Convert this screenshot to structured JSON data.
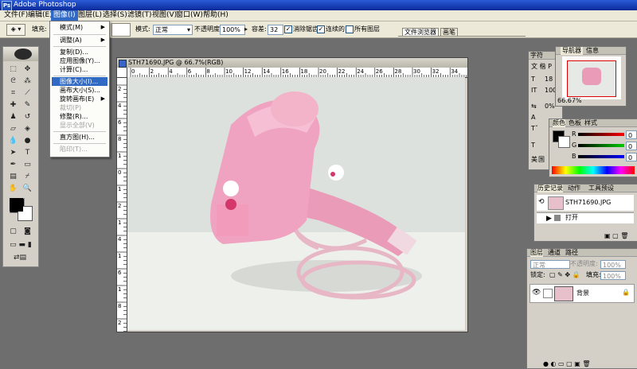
{
  "app": {
    "title": "Adobe Photoshop",
    "logo": "Ps"
  },
  "menu": [
    "文件(F)",
    "编辑(E)",
    "图像(I)",
    "图层(L)",
    "选择(S)",
    "滤镜(T)",
    "视图(V)",
    "窗口(W)",
    "帮助(H)"
  ],
  "options": {
    "fill_label": "填充:",
    "mode_label": "模式:",
    "mode_value": "正常",
    "opacity_label": "不透明度:",
    "opacity_value": "100%",
    "tolerance_label": "容差:",
    "tolerance_value": "32",
    "antialias_label": "消除锯齿",
    "contiguous_label": "连续的",
    "all_layers_label": "所有图层",
    "right_tabs": [
      "文件浏览器",
      "画笔"
    ]
  },
  "image_menu": {
    "items": [
      "模式(M)",
      "调整(A)",
      "复制(D)...",
      "应用图像(Y)...",
      "计算(C)...",
      "图像大小(I)...",
      "画布大小(S)...",
      "旋转画布(E)",
      "裁切(P)",
      "修整(R)...",
      "显示全部(V)",
      "直方图(H)...",
      "陷印(T)..."
    ]
  },
  "document": {
    "title": "STH71690.JPG @ 66.7%(RGB)",
    "ruler_labels": [
      "0",
      "2",
      "4",
      "6",
      "8",
      "10",
      "12",
      "14",
      "16",
      "18",
      "20",
      "22",
      "24",
      "26",
      "28",
      "30",
      "32",
      "34"
    ],
    "ruler_v_labels": [
      "2",
      "4",
      "6",
      "8",
      "1",
      "0",
      "1",
      "2",
      "1",
      "4",
      "1",
      "6",
      "1",
      "8",
      "2"
    ]
  },
  "character_panel": {
    "tabs": [
      "字符",
      "段落"
    ],
    "font_row": "文 楷 P",
    "size1": "18",
    "size2": "100",
    "pct": "0%"
  },
  "navigator_panel": {
    "tabs": [
      "导航器",
      "信息"
    ],
    "zoom": "66.67%"
  },
  "color_panel": {
    "tabs": [
      "颜色",
      "色板",
      "样式"
    ],
    "r_label": "R",
    "g_label": "G",
    "b_label": "B",
    "r_value": "0",
    "g_value": "0",
    "b_value": "0"
  },
  "history_panel": {
    "tabs": [
      "历史记录",
      "动作",
      "工具预设"
    ],
    "snapshot": "STH71690.JPG",
    "step": "打开"
  },
  "layers_panel": {
    "tabs": [
      "图层",
      "通道",
      "路径"
    ],
    "mode": "正常",
    "opacity_label": "不透明度:",
    "opacity_value": "100%",
    "lock_label": "锁定:",
    "fill_label": "填充:",
    "fill_value": "100%",
    "layer_name": "背景"
  },
  "side_letters": {
    "a": "美",
    "b": "国"
  }
}
